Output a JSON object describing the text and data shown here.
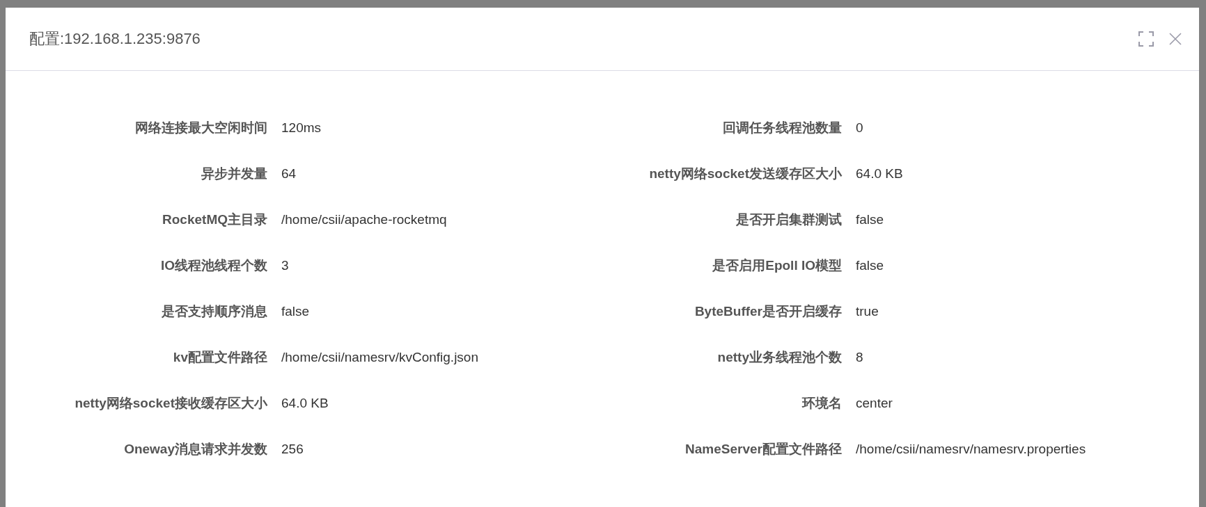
{
  "dialog": {
    "title": "配置:192.168.1.235:9876"
  },
  "fields": [
    {
      "label": "网络连接最大空闲时间",
      "value": "120ms"
    },
    {
      "label": "回调任务线程池数量",
      "value": "0"
    },
    {
      "label": "异步并发量",
      "value": "64"
    },
    {
      "label": "netty网络socket发送缓存区大小",
      "value": "64.0 KB"
    },
    {
      "label": "RocketMQ主目录",
      "value": "/home/csii/apache-rocketmq"
    },
    {
      "label": "是否开启集群测试",
      "value": "false"
    },
    {
      "label": "IO线程池线程个数",
      "value": "3"
    },
    {
      "label": "是否启用Epoll IO模型",
      "value": "false"
    },
    {
      "label": "是否支持顺序消息",
      "value": "false"
    },
    {
      "label": "ByteBuffer是否开启缓存",
      "value": "true"
    },
    {
      "label": "kv配置文件路径",
      "value": "/home/csii/namesrv/kvConfig.json"
    },
    {
      "label": "netty业务线程池个数",
      "value": "8"
    },
    {
      "label": "netty网络socket接收缓存区大小",
      "value": "64.0 KB"
    },
    {
      "label": "环境名",
      "value": "center"
    },
    {
      "label": "Oneway消息请求并发数",
      "value": "256"
    },
    {
      "label": "NameServer配置文件路径",
      "value": "/home/csii/namesrv/namesrv.properties"
    }
  ]
}
